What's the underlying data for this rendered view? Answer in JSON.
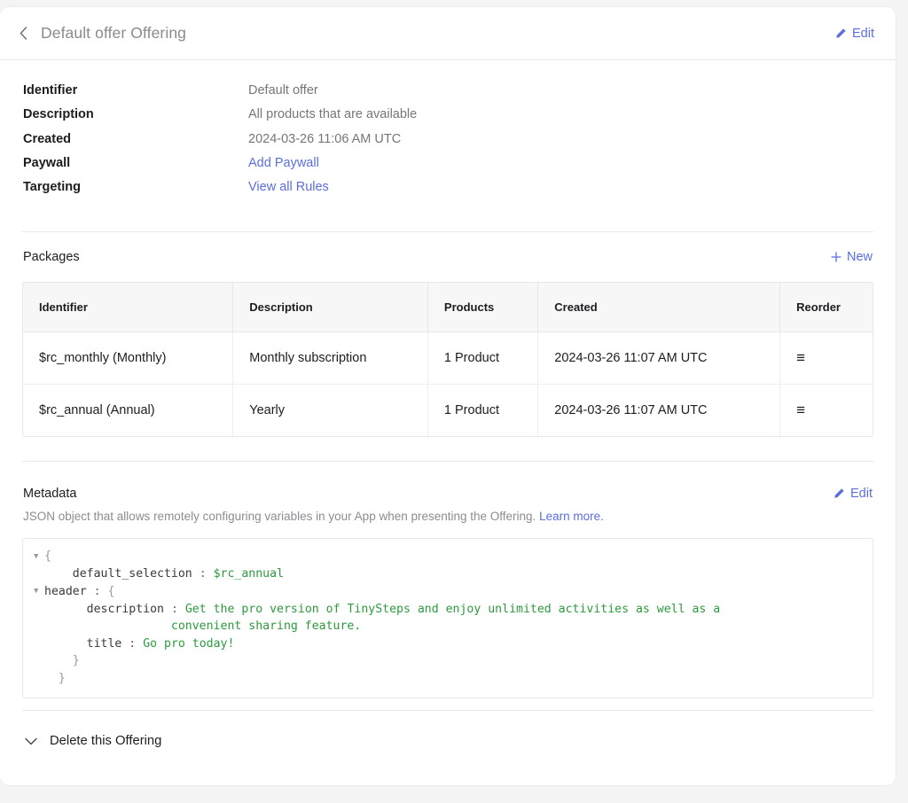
{
  "header": {
    "back_icon": "chevron-left-icon",
    "title": "Default offer Offering",
    "edit_label": "Edit",
    "edit_icon": "pencil-icon"
  },
  "details": [
    {
      "label": "Identifier",
      "value": "Default offer",
      "is_link": false
    },
    {
      "label": "Description",
      "value": "All products that are available",
      "is_link": false
    },
    {
      "label": "Created",
      "value": "2024-03-26 11:06 AM UTC",
      "is_link": false
    },
    {
      "label": "Paywall",
      "value": "Add Paywall",
      "is_link": true
    },
    {
      "label": "Targeting",
      "value": "View all Rules",
      "is_link": true
    }
  ],
  "packages": {
    "title": "Packages",
    "new_label": "New",
    "new_icon": "plus-icon",
    "columns": [
      "Identifier",
      "Description",
      "Products",
      "Created",
      "Reorder"
    ],
    "rows": [
      {
        "identifier": "$rc_monthly (Monthly)",
        "description": "Monthly subscription",
        "products": "1 Product",
        "created": "2024-03-26 11:07 AM UTC",
        "reorder_icon": "hamburger-drag-handle-icon",
        "reorder_glyph": "≡"
      },
      {
        "identifier": "$rc_annual (Annual)",
        "description": "Yearly",
        "products": "1 Product",
        "created": "2024-03-26 11:07 AM UTC",
        "reorder_icon": "hamburger-drag-handle-icon",
        "reorder_glyph": "≡"
      }
    ]
  },
  "metadata": {
    "title": "Metadata",
    "edit_label": "Edit",
    "edit_icon": "pencil-icon",
    "description": "JSON object that allows remotely configuring variables in your App when presenting the Offering.",
    "learn_more_label": "Learn more.",
    "json": {
      "open_brace": "{",
      "close_brace": "}",
      "default_selection_key": "default_selection",
      "default_selection_value": "$rc_annual",
      "header_key": "header",
      "header_open_brace": "{",
      "header_close_brace": "}",
      "description_key": "description",
      "description_value_line1": "Get the pro version of TinySteps and enjoy unlimited activities as well as a",
      "description_value_line2": "convenient sharing feature.",
      "title_key": "title",
      "title_value": "Go pro today!",
      "colon": ":",
      "collapse_icon": "triangle-down-icon"
    }
  },
  "footer": {
    "expand_icon": "chevron-down-icon",
    "delete_label": "Delete this Offering"
  },
  "colors": {
    "accent_link": "#5a6ee0",
    "json_value": "#2c9a3d",
    "page_background": "#f4f4f5",
    "card_background": "#ffffff",
    "table_header_background": "#f7f7f8"
  }
}
